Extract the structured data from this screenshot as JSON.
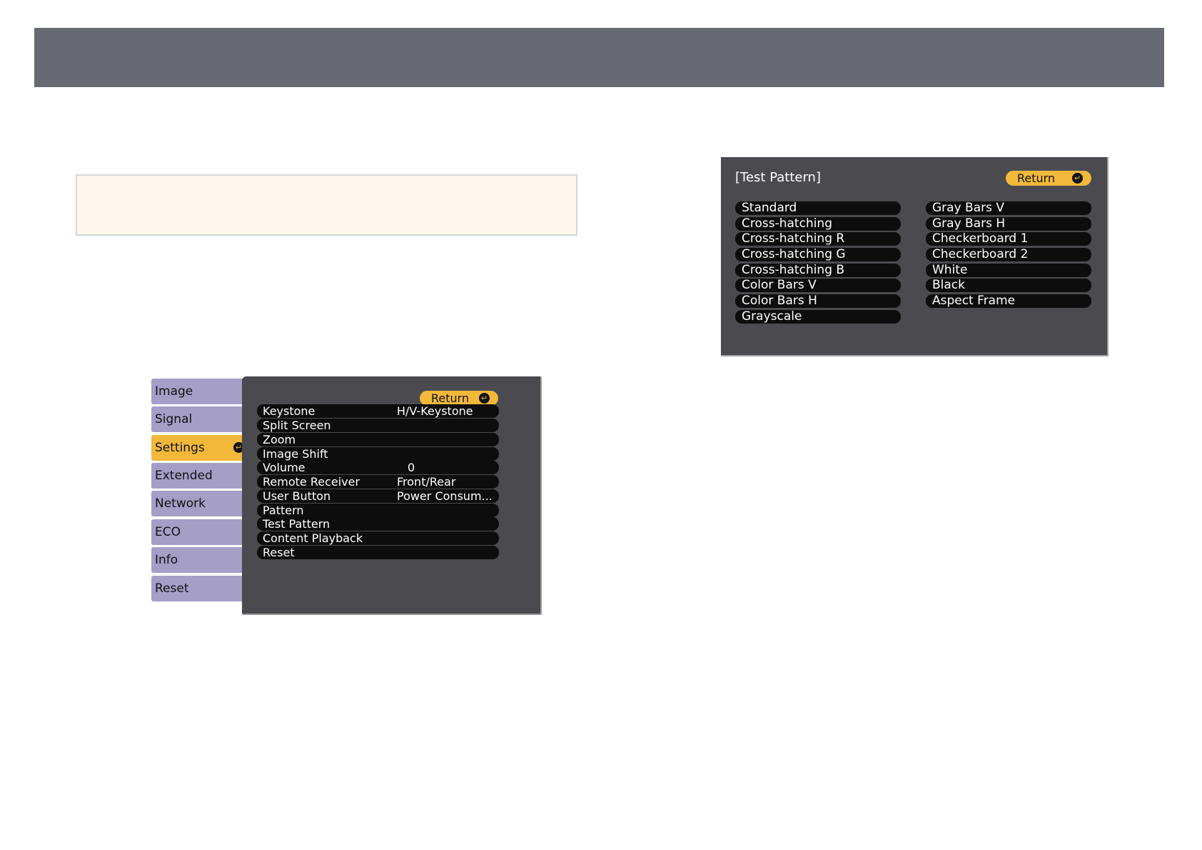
{
  "page": {
    "header_color": "#676a73",
    "note_box_color": "#fdf8e9"
  },
  "settings_menu": {
    "tabs": [
      {
        "label": "Image",
        "active": false
      },
      {
        "label": "Signal",
        "active": false
      },
      {
        "label": "Settings",
        "active": true
      },
      {
        "label": "Extended",
        "active": false
      },
      {
        "label": "Network",
        "active": false
      },
      {
        "label": "ECO",
        "active": false
      },
      {
        "label": "Info",
        "active": false
      },
      {
        "label": "Reset",
        "active": false
      }
    ],
    "return_label": "Return",
    "enter_icon": "enter-icon",
    "items": [
      {
        "label": "Keystone",
        "value": "H/V-Keystone"
      },
      {
        "label": "Split Screen",
        "value": ""
      },
      {
        "label": "Zoom",
        "value": ""
      },
      {
        "label": "Image Shift",
        "value": ""
      },
      {
        "label": "Volume",
        "value": "0"
      },
      {
        "label": "Remote Receiver",
        "value": "Front/Rear"
      },
      {
        "label": "User Button",
        "value": "Power Consum..."
      },
      {
        "label": "Pattern",
        "value": ""
      },
      {
        "label": "Test Pattern",
        "value": ""
      },
      {
        "label": "Content Playback",
        "value": ""
      },
      {
        "label": "Reset",
        "value": ""
      }
    ],
    "colors": {
      "tab": "#a59ec7",
      "active_tab": "#f1b83a",
      "panel": "#4b4b4f"
    }
  },
  "test_pattern": {
    "title": "[Test Pattern]",
    "return_label": "Return",
    "left_column": [
      "Standard",
      "Cross-hatching",
      "Cross-hatching R",
      "Cross-hatching G",
      "Cross-hatching B",
      "Color Bars V",
      "Color Bars H",
      "Grayscale"
    ],
    "right_column": [
      "Gray Bars V",
      "Gray Bars H",
      "Checkerboard 1",
      "Checkerboard 2",
      "White",
      "Black",
      "Aspect Frame"
    ]
  }
}
